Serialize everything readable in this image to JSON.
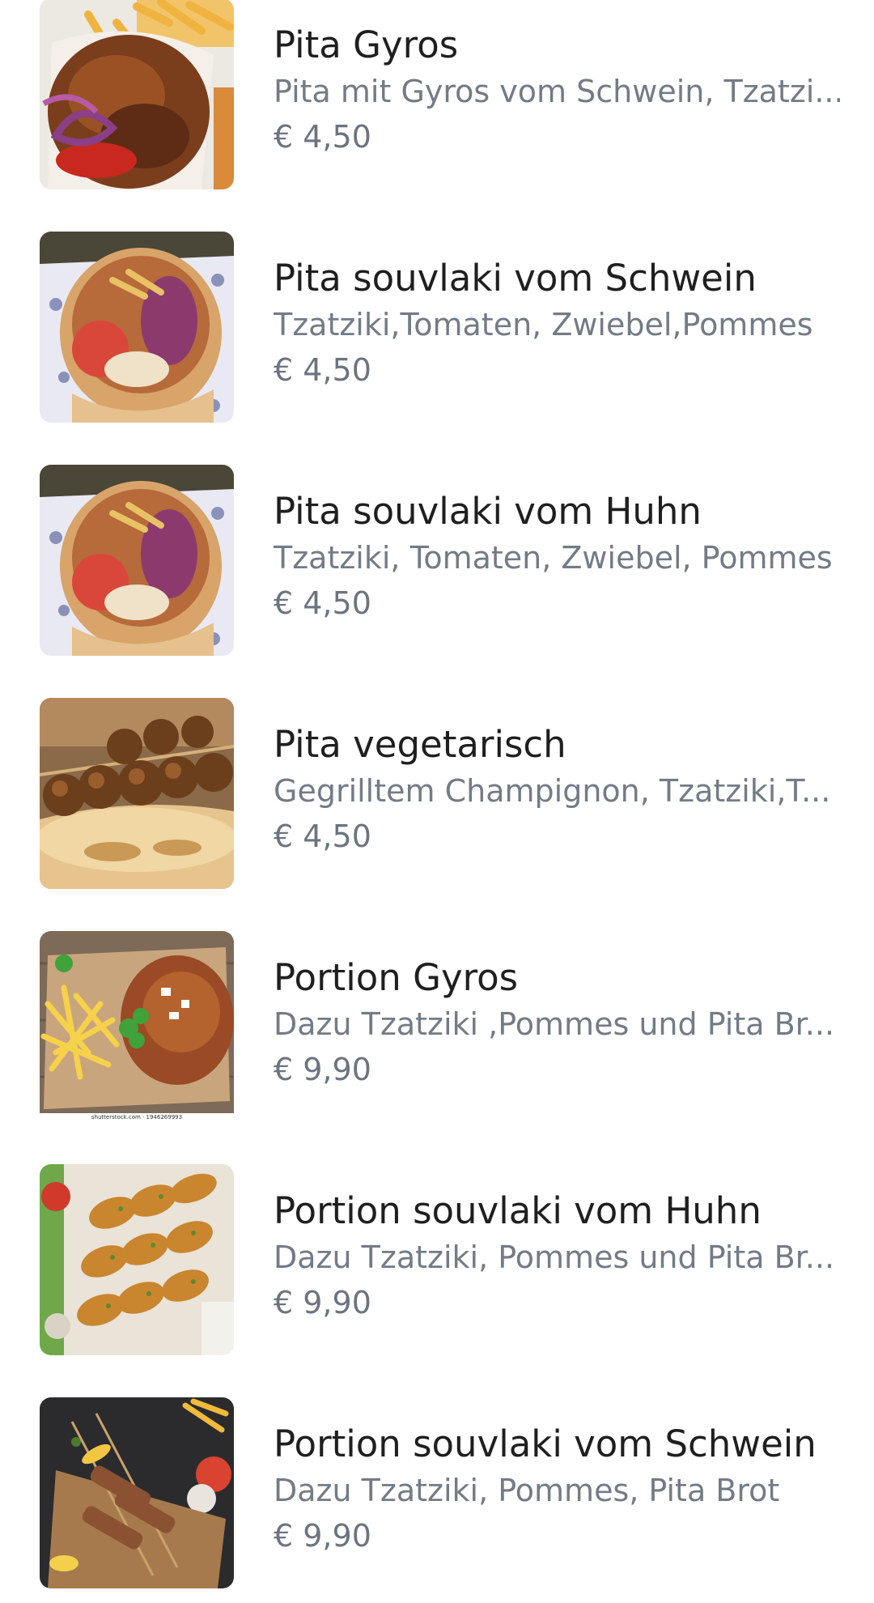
{
  "menu": {
    "items": [
      {
        "name": "Pita Gyros",
        "description": "Pita mit Gyros vom Schwein, Tzatzi...",
        "price": "€ 4,50",
        "image": "pita-gyros-photo"
      },
      {
        "name": "Pita souvlaki vom Schwein",
        "description": "Tzatziki,Tomaten, Zwiebel,Pommes",
        "price": "€ 4,50",
        "image": "pita-souvlaki-photo"
      },
      {
        "name": "Pita souvlaki vom Huhn",
        "description": "Tzatziki, Tomaten, Zwiebel, Pommes",
        "price": "€ 4,50",
        "image": "pita-souvlaki-photo"
      },
      {
        "name": "Pita vegetarisch",
        "description": "Gegrilltem Champignon, Tzatziki,T...",
        "price": "€ 4,50",
        "image": "mushroom-skewer-photo"
      },
      {
        "name": "Portion Gyros",
        "description": "Dazu Tzatziki ,Pommes und Pita Br...",
        "price": "€ 9,90",
        "image": "gyros-plate-photo",
        "watermark": "shutterstock.com · 1946269993"
      },
      {
        "name": "Portion souvlaki vom Huhn",
        "description": "Dazu Tzatziki, Pommes und Pita Br...",
        "price": "€ 9,90",
        "image": "chicken-skewers-photo"
      },
      {
        "name": "Portion souvlaki vom Schwein",
        "description": "Dazu Tzatziki, Pommes, Pita Brot",
        "price": "€ 9,90",
        "image": "pork-skewers-photo"
      }
    ]
  },
  "colors": {
    "title": "#1f1f1f",
    "description": "#737b86",
    "price": "#6c747f",
    "background": "#ffffff"
  }
}
